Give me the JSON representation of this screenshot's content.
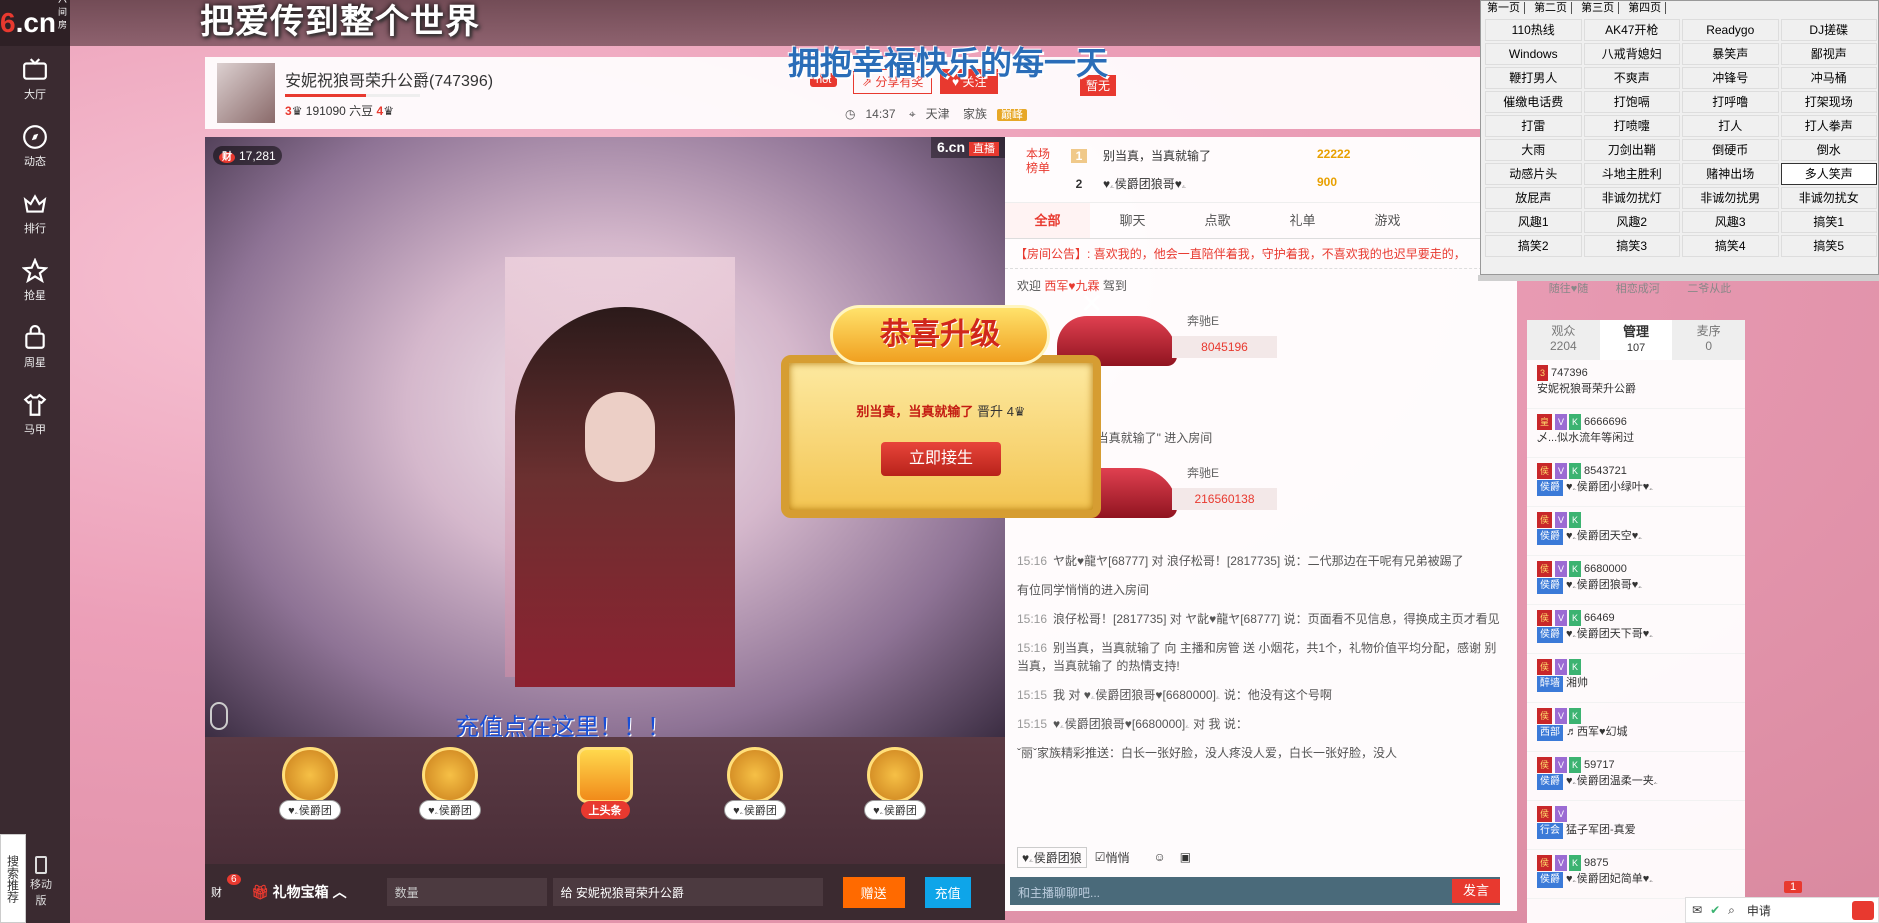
{
  "site": {
    "logo_text": "6.cn",
    "logo_sub": "六间房"
  },
  "nav": [
    {
      "label": "大厅",
      "icon": "tv-icon"
    },
    {
      "label": "动态",
      "icon": "compass-icon"
    },
    {
      "label": "排行",
      "icon": "crown-icon"
    },
    {
      "label": "抢星",
      "icon": "star-icon"
    },
    {
      "label": "周星",
      "icon": "bag-icon"
    },
    {
      "label": "马甲",
      "icon": "shirt-icon"
    }
  ],
  "side": {
    "search": "搜索推荐",
    "mobile": "移动版"
  },
  "banner": {
    "title": "把爱传到整个世界",
    "marquee": "拥抱幸福快乐的每一天"
  },
  "room": {
    "name": "安妮祝狼哥荣升公爵(747396)",
    "level_left": "3",
    "beans": "191090 六豆",
    "level_right": "4",
    "hot": "hot",
    "share": "分享有奖",
    "follow": "关注",
    "zanwu": "暂无",
    "time": "14:37",
    "city": "天津",
    "family_label": "家族",
    "family_tag": "巅峰"
  },
  "video": {
    "viewer_count": "17,281",
    "viewer_icon": "财",
    "brand": "6.cn",
    "live": "直播",
    "recharge_text": "充值点在这里！！！"
  },
  "seats": [
    {
      "label": "♥ۦ侯爵团"
    },
    {
      "label": "♥ۦ侯爵团"
    },
    {
      "label": "上头条"
    },
    {
      "label": "♥ۦ侯爵团"
    },
    {
      "label": "♥ۦ侯爵团"
    }
  ],
  "giftbar": {
    "bag": "财",
    "bag_count": "6",
    "box": "礼物宝箱",
    "qty_placeholder": "数量",
    "to_label": "给",
    "to_value": "安妮祝狼哥荣升公爵",
    "send": "赠送",
    "pay": "充值"
  },
  "rank": {
    "label": "本场榜单",
    "rows": [
      {
        "pos": "1",
        "name": "别当真，当真就输了",
        "amount": "22222"
      },
      {
        "pos": "2",
        "name": "♥ۦ侯爵团狼哥♥ۦ",
        "amount": "900"
      }
    ]
  },
  "chat_tabs": [
    "全部",
    "聊天",
    "点歌",
    "礼单",
    "游戏"
  ],
  "notice": {
    "label": "【房间公告】:",
    "text": "喜欢我的，他会一直陪伴着我，守护着我，不喜欢我的也迟早要走的，"
  },
  "welcome": {
    "prefix": "欢迎",
    "name": "西军♥九霖",
    "suffix": "驾到"
  },
  "cars": [
    {
      "name": "奔驰E",
      "num": "8045196"
    },
    {
      "name": "奔驰E",
      "num": "216560138"
    }
  ],
  "messages": [
    {
      "text": "入房间"
    },
    {
      "text": "守护 \"别当真，当真就输了\" 进入房间"
    },
    {
      "time": "15:16",
      "text": "ヤ龀♥龍ヤ[68777] 对 浪仔松哥！[2817735] 说：二代那边在干呢有兄弟被踢了"
    },
    {
      "text": "有位同学悄悄的进入房间"
    },
    {
      "time": "15:16",
      "text": "浪仔松哥！[2817735] 对 ヤ龀♥龍ヤ[68777] 说：页面看不见信息，得换成主页才看见"
    },
    {
      "time": "15:16",
      "text": "别当真，当真就输了 向 主播和房管 送 小烟花，共1个，礼物价值平均分配，感谢 别当真，当真就输了 的热情支持!"
    },
    {
      "time": "15:15",
      "text": "我 对 ♥ۦ侯爵团狼哥♥ۦ[6680000] 说：他没有这个号啊"
    },
    {
      "time": "15:15",
      "text": "♥ۦ侯爵团狼哥♥ۦ[6680000] 对 我 说："
    },
    {
      "text": "ˇ丽ˇ家族精彩推送：白长一张好脸，没人疼没人爱，白长一张好脸，没人"
    }
  ],
  "chat_input": {
    "target": "♥ۦ侯爵团狼",
    "private": "悄悄",
    "placeholder": "和主播聊聊吧...",
    "send": "发言"
  },
  "popup": {
    "title": "恭喜升级",
    "user": "别当真，当真就输了",
    "text": "晋升",
    "level": "4",
    "accept": "立即接生"
  },
  "user_panel": {
    "top_icons": [
      "随往♥随",
      "相恋成河",
      "二爷从此"
    ],
    "tabs": [
      {
        "label": "观众",
        "count": "2204"
      },
      {
        "label": "管理",
        "count": "107"
      },
      {
        "label": "麦序",
        "count": "0"
      }
    ],
    "users": [
      {
        "level": "3",
        "id": "747396",
        "name": "安妮祝狼哥荣升公爵"
      },
      {
        "level": "皇",
        "id": "6666696",
        "name": "乄...似水流年等闲过"
      },
      {
        "level": "侯",
        "id": "8543721",
        "tag": "侯爵",
        "name": "♥ۦ侯爵团小绿叶♥ۦ"
      },
      {
        "level": "侯",
        "id": "",
        "tag": "侯爵",
        "name": "♥ۦ侯爵团天空♥ۦ"
      },
      {
        "level": "侯",
        "id": "6680000",
        "tag": "侯爵",
        "name": "♥ۦ侯爵团狼哥♥ۦ"
      },
      {
        "level": "侯",
        "id": "66469",
        "tag": "侯爵",
        "name": "♥ۦ侯爵团天下哥♥ۦ"
      },
      {
        "level": "侯",
        "id": "",
        "tag": "醉墙",
        "name": "湘帅"
      },
      {
        "level": "侯",
        "id": "",
        "tag": "西部",
        "name": "♬西军♥幻城"
      },
      {
        "level": "侯",
        "id": "59717",
        "tag": "侯爵",
        "name": "♥ۦ侯爵团温柔一夹ۦ"
      },
      {
        "level": "侯",
        "id": "",
        "tag": "行会",
        "name": "猛子军团-真爱"
      },
      {
        "level": "侯",
        "id": "9875",
        "tag": "侯爵",
        "name": "♥ۦ侯爵团妃简单♥ۦ"
      }
    ]
  },
  "soundboard": {
    "tabs": [
      "第一页",
      "第二页",
      "第三页",
      "第四页"
    ],
    "buttons": [
      "110热线",
      "AK47开枪",
      "Readygo",
      "DJ搓碟",
      "Windows",
      "八戒背媳妇",
      "暴笑声",
      "鄙视声",
      "鞭打男人",
      "不爽声",
      "冲锋号",
      "冲马桶",
      "催缴电话费",
      "打饱嗝",
      "打呼噜",
      "打架现场",
      "打雷",
      "打喷嚏",
      "打人",
      "打人拳声",
      "大雨",
      "刀剑出鞘",
      "倒硬币",
      "倒水",
      "动感片头",
      "斗地主胜利",
      "赌神出场",
      "多人笑声",
      "放屁声",
      "非诚勿扰灯",
      "非诚勿扰男",
      "非诚勿扰女",
      "风趣1",
      "风趣2",
      "风趣3",
      "搞笑1",
      "搞笑2",
      "搞笑3",
      "搞笑4",
      "搞笑5"
    ],
    "selected": "多人笑声"
  },
  "tray": {
    "apply": "申请",
    "badge": "1"
  }
}
